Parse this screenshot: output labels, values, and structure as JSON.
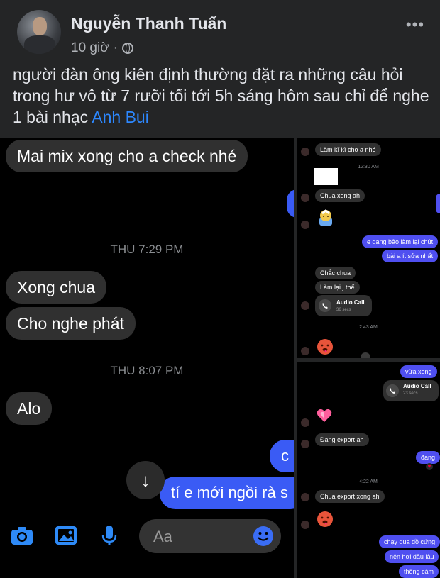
{
  "post": {
    "author": "Nguyễn Thanh Tuấn",
    "time": "10 giờ",
    "separator": "·",
    "more": "•••",
    "text": "người đàn ông kiên định thường đặt ra những câu hỏi trong hư vô từ 7 rưỡi tối tới 5h sáng hôm sau chỉ để nghe 1 bài nhạc",
    "tag": "Anh Bui"
  },
  "chat_main": {
    "messages": [
      {
        "text": "Mai mix xong cho a check nhé"
      },
      {
        "text": "Xong chua"
      },
      {
        "text": "Cho nghe phát"
      },
      {
        "text": "Alo"
      }
    ],
    "timestamps": [
      "THU 7:29 PM",
      "THU 8:07 PM"
    ],
    "outgoing": [
      "c",
      "tí e mới ngồi rà s"
    ],
    "scroll_icon": "↓",
    "composer_placeholder": "Aa"
  },
  "chat_right_top": {
    "msg1": "Làm kĩ kĩ cho a nhé",
    "ts1": "12:30 AM",
    "msg2": "Chua xong ah",
    "out1": "e đang bảo làm lại chút",
    "out2": "bài a ít sửa nhất",
    "msg3": "Chắc chua",
    "msg4": "Làm lại j thế",
    "call_title": "Audio Call",
    "call_sub": "36 secs",
    "ts2": "2:43 AM"
  },
  "chat_right_bottom": {
    "out1": "vừa xong",
    "call_title": "Audio Call",
    "call_sub": "23 secs",
    "msg1": "Đang export ah",
    "out2": "đang",
    "ts1": "4:22 AM",
    "msg2": "Chua export xong ah",
    "out3": "chạy qua đồ cứng",
    "out4": "nên hơi đầu lâu",
    "out5": "thông cảm"
  },
  "colors": {
    "outgoing": "#3a5bf5",
    "incoming": "#303030",
    "link": "#2d88ff"
  }
}
